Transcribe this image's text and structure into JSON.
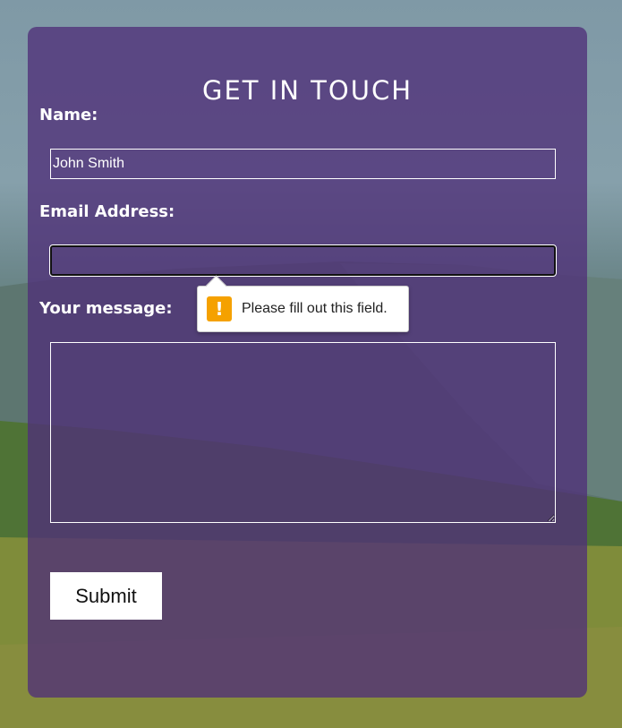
{
  "form": {
    "title": "GET IN TOUCH",
    "name_label": "Name:",
    "name_value": "John Smith",
    "email_label": "Email Address:",
    "email_value": "",
    "message_label": "Your message:",
    "message_value": "",
    "submit_label": "Submit"
  },
  "validation_tooltip": {
    "icon": "warning-icon",
    "icon_glyph": "!",
    "text": "Please fill out this field."
  },
  "colors": {
    "card_overlay": "#503078",
    "warning": "#f5a100",
    "text": "#ffffff"
  }
}
